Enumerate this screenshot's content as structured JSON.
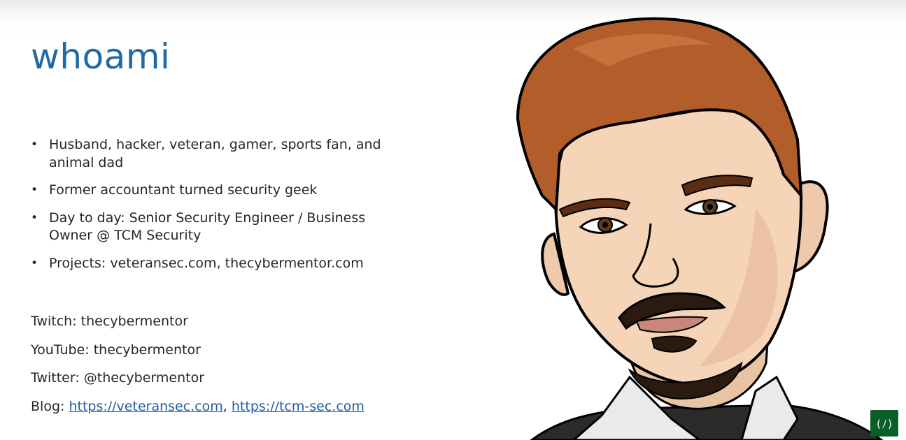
{
  "slide": {
    "title": "whoami",
    "bullets": [
      {
        "marker": "•",
        "text": "Husband, hacker, veteran, gamer, sports fan, and animal dad"
      },
      {
        "marker": "•",
        "text": "Former accountant turned security geek"
      },
      {
        "marker": "•",
        "text": "Day to day: Senior Security Engineer / Business Owner @ TCM Security"
      },
      {
        "marker": "•",
        "text": "Projects: veteransec.com, thecybermentor.com"
      }
    ],
    "contacts": {
      "twitch": "Twitch: thecybermentor",
      "youtube": "YouTube: thecybermentor",
      "twitter": "Twitter: @thecybermentor",
      "blog_label": "Blog: ",
      "blog_link_1": "https://veteransec.com",
      "blog_separator": ",",
      "blog_link_2": "https://tcm-sec.com"
    }
  },
  "badge": {
    "glyph": "(ﾉ)"
  },
  "colors": {
    "title": "#1f6aa5",
    "link": "#1f5fa8",
    "text": "#262626",
    "badge": "#0a5e2a"
  },
  "icons": {
    "portrait": "cartoon-portrait-illustration",
    "badge": "freecodecamp-logo-icon"
  }
}
